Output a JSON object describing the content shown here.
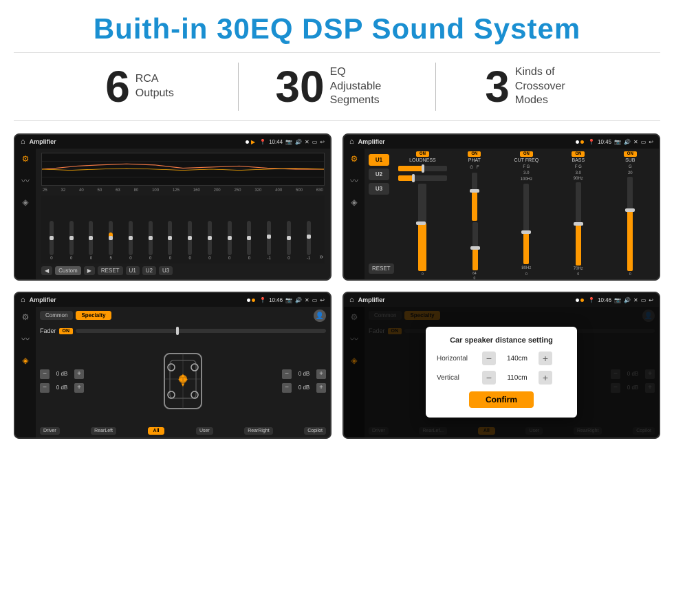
{
  "header": {
    "title": "Buith-in 30EQ DSP Sound System"
  },
  "stats": [
    {
      "number": "6",
      "label": "RCA\nOutputs"
    },
    {
      "number": "30",
      "label": "EQ Adjustable\nSegments"
    },
    {
      "number": "3",
      "label": "Kinds of\nCrossover Modes"
    }
  ],
  "screens": {
    "eq": {
      "appName": "Amplifier",
      "time": "10:44",
      "freqLabels": [
        "25",
        "32",
        "40",
        "50",
        "63",
        "80",
        "100",
        "125",
        "160",
        "200",
        "250",
        "320",
        "400",
        "500",
        "630"
      ],
      "sliderValues": [
        "0",
        "0",
        "0",
        "5",
        "0",
        "0",
        "0",
        "0",
        "0",
        "0",
        "0",
        "-1",
        "0",
        "-1"
      ],
      "navButtons": [
        "◀",
        "Custom",
        "▶",
        "RESET",
        "U1",
        "U2",
        "U3"
      ]
    },
    "crossover": {
      "appName": "Amplifier",
      "time": "10:45",
      "presets": [
        "U1",
        "U2",
        "U3"
      ],
      "channels": [
        {
          "name": "LOUDNESS",
          "on": true
        },
        {
          "name": "PHAT",
          "on": true
        },
        {
          "name": "CUT FREQ",
          "on": true
        },
        {
          "name": "BASS",
          "on": true
        },
        {
          "name": "SUB",
          "on": true
        }
      ]
    },
    "speaker1": {
      "appName": "Amplifier",
      "time": "10:46",
      "tabs": [
        "Common",
        "Specialty"
      ],
      "faderLabel": "Fader",
      "faderOn": "ON",
      "controls": {
        "leftTop": "0 dB",
        "leftBottom": "0 dB",
        "rightTop": "0 dB",
        "rightBottom": "0 dB"
      },
      "bottomBtns": [
        "Driver",
        "RearLeft",
        "All",
        "User",
        "RearRight",
        "Copilot"
      ]
    },
    "speaker2": {
      "appName": "Amplifier",
      "time": "10:46",
      "tabs": [
        "Common",
        "Specialty"
      ],
      "dialog": {
        "title": "Car speaker distance setting",
        "horizontal": {
          "label": "Horizontal",
          "value": "140cm"
        },
        "vertical": {
          "label": "Vertical",
          "value": "110cm"
        },
        "confirm": "Confirm"
      },
      "controls": {
        "rightTop": "0 dB",
        "rightBottom": "0 dB"
      },
      "bottomBtns": [
        "Driver",
        "RearLeft",
        "All",
        "User",
        "RearRight",
        "Copilot"
      ]
    }
  }
}
